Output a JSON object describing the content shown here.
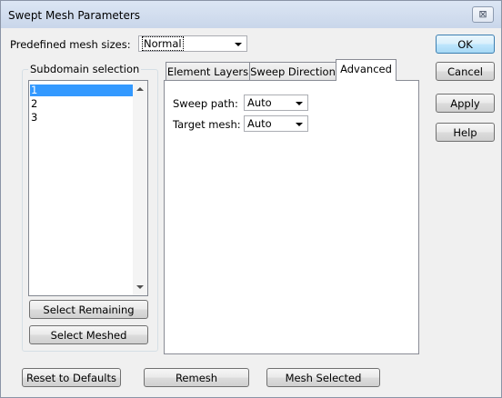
{
  "window": {
    "title": "Swept Mesh Parameters",
    "close_glyph": "⊠"
  },
  "mesh_sizes": {
    "label": "Predefined mesh sizes:",
    "value": "Normal"
  },
  "subdomain": {
    "group_label": "Subdomain selection",
    "items": [
      "1",
      "2",
      "3"
    ],
    "select_remaining": "Select Remaining",
    "select_meshed": "Select Meshed"
  },
  "tabs": [
    {
      "label": "Element Layers"
    },
    {
      "label": "Sweep Direction"
    },
    {
      "label": "Advanced"
    }
  ],
  "advanced": {
    "sweep_path_label": "Sweep path:",
    "sweep_path_value": "Auto",
    "target_mesh_label": "Target mesh:",
    "target_mesh_value": "Auto"
  },
  "side_buttons": {
    "ok": "OK",
    "cancel": "Cancel",
    "apply": "Apply",
    "help": "Help"
  },
  "bottom_buttons": {
    "reset": "Reset to Defaults",
    "remesh": "Remesh",
    "mesh_selected": "Mesh Selected"
  }
}
